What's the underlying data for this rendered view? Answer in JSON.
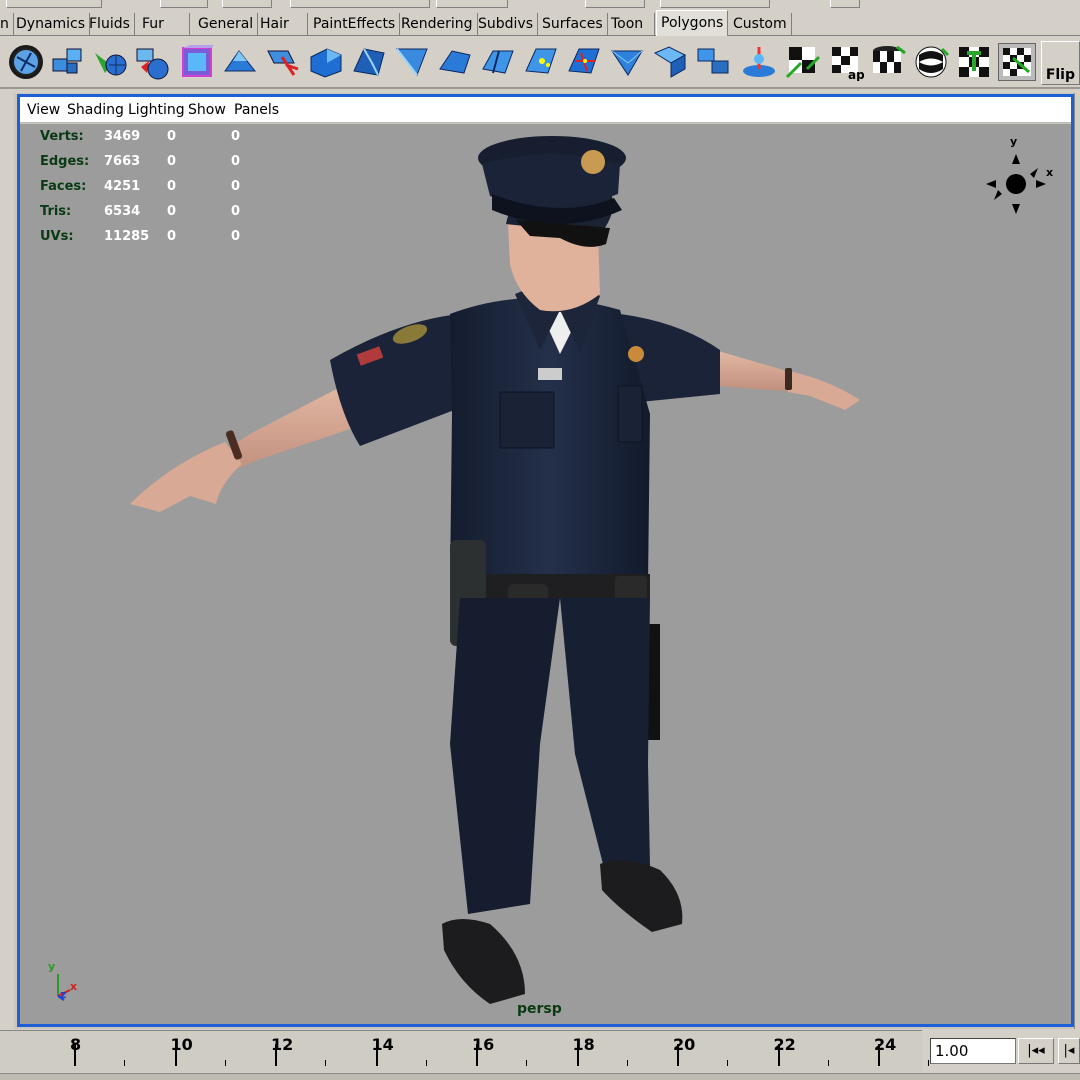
{
  "shelf_tabs": [
    "n",
    "Dynamics",
    "Fluids",
    "Fur",
    "General",
    "Hair",
    "PaintEffects",
    "Rendering",
    "Subdivs",
    "Surfaces",
    "Toon",
    "Polygons",
    "Custom"
  ],
  "active_tab": "Polygons",
  "shelf_icons": [
    "mesh-sphere-icon",
    "combine-icon",
    "separate-icon",
    "extract-icon",
    "smooth-proxy-icon",
    "extrude-face-icon",
    "select-icon",
    "extrude-edge-icon",
    "bevel-icon",
    "split-polygon-icon",
    "wedge-face-icon",
    "cut-faces-icon",
    "merge-vertices-icon",
    "soft-edge-icon",
    "triangulate-icon",
    "quadrangulate-icon",
    "append-polygon-icon",
    "sculpt-icon",
    "planar-map-icon",
    "automatic-map-icon",
    "cylindrical-map-icon",
    "spherical-map-icon",
    "uv-snapshot-icon",
    "uv-texture-editor-icon"
  ],
  "shelf_flip_label": "Flip",
  "panel_menu": [
    "View",
    "Shading",
    "Lighting",
    "Show",
    "Panels"
  ],
  "hud_stats": [
    {
      "label": "Verts:",
      "v1": "3469",
      "v2": "0",
      "v3": "0"
    },
    {
      "label": "Edges:",
      "v1": "7663",
      "v2": "0",
      "v3": "0"
    },
    {
      "label": "Faces:",
      "v1": "4251",
      "v2": "0",
      "v3": "0"
    },
    {
      "label": "Tris:",
      "v1": "6534",
      "v2": "0",
      "v3": "0"
    },
    {
      "label": "UVs:",
      "v1": "11285",
      "v2": "0",
      "v3": "0"
    }
  ],
  "camera_label": "persp",
  "view_cube": {
    "y": "y",
    "x": "x"
  },
  "axis": {
    "y": "y",
    "x": "x",
    "z": "z"
  },
  "time_ticks": [
    "8",
    "10",
    "12",
    "14",
    "16",
    "18",
    "20",
    "22",
    "24"
  ],
  "current_frame": "1.00",
  "colors": {
    "panel_border": "#1e5fd6",
    "viewport_bg": "#9c9c9c",
    "hud_label": "#0a3a12"
  }
}
